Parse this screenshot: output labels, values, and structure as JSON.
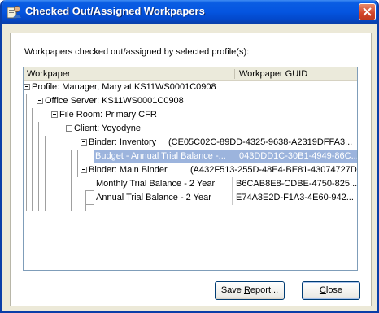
{
  "window": {
    "title": "Checked Out/Assigned Workpapers",
    "description": "Workpapers checked out/assigned by selected profile(s):"
  },
  "table": {
    "columns": [
      "Workpaper",
      "Workpaper GUID"
    ],
    "rows": [
      {
        "label": "Profile: Manager, Mary at KS11WS0001C0908",
        "guid": ""
      },
      {
        "label": "Office Server: KS11WS0001C0908",
        "guid": ""
      },
      {
        "label": "File Room: Primary CFR",
        "guid": ""
      },
      {
        "label": "Client: Yoyodyne",
        "guid": ""
      },
      {
        "label": "Binder: Inventory",
        "guid": "(CE05C02C-89DD-4325-9638-A2319DFFA3..."
      },
      {
        "label": "Budget - Annual Trial Balance -...",
        "guid": "043DDD1C-30B1-4949-86C...",
        "selected": true
      },
      {
        "label": "Binder: Main Binder",
        "guid": "(A432F513-255D-48E4-BE81-43074727D..."
      },
      {
        "label": "Monthly Trial Balance - 2 Year",
        "guid": "B6CAB8E8-CDBE-4750-825..."
      },
      {
        "label": "Annual Trial Balance - 2 Year",
        "guid": "E74A3E2D-F1A3-4E60-942..."
      }
    ]
  },
  "buttons": {
    "save_report_prefix": "Save ",
    "save_report_mnemonic": "R",
    "save_report_suffix": "eport...",
    "close_mnemonic": "C",
    "close_suffix": "lose"
  },
  "colors": {
    "titlebar": "#0555e0",
    "selection": "#9cb4dd",
    "dialog_bg": "#ece9d8"
  },
  "icons": [
    "app-icon",
    "close-icon",
    "collapse-icon"
  ]
}
